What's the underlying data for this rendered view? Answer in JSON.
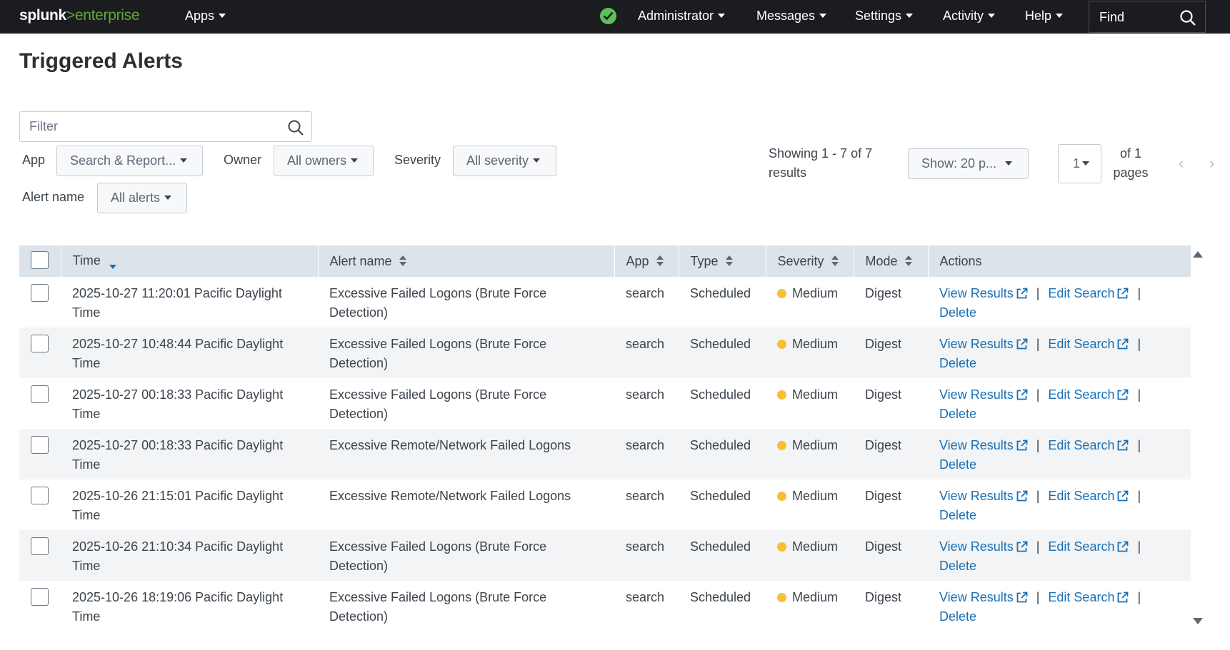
{
  "topbar": {
    "logo_word": "splunk",
    "logo_suffix": ">enterprise",
    "apps": "Apps",
    "user": "Administrator",
    "messages": "Messages",
    "settings": "Settings",
    "activity": "Activity",
    "help": "Help",
    "find": "Find",
    "status_color": "#5cc05c"
  },
  "page": {
    "title": "Triggered Alerts"
  },
  "filters": {
    "filter_placeholder": "Filter",
    "app_label": "App",
    "app_value": "Search & Report...",
    "owner_label": "Owner",
    "owner_value": "All owners",
    "severity_label": "Severity",
    "severity_value": "All severity",
    "alert_name_label": "Alert name",
    "alert_name_value": "All alerts"
  },
  "pagination": {
    "showing": "Showing 1 - 7 of 7 results",
    "page_size": "Show: 20 p...",
    "current_page": "1",
    "of_pages": "of 1 pages",
    "prev_icon": "chevron-left-icon",
    "next_icon": "chevron-right-icon"
  },
  "table": {
    "columns": [
      "Time",
      "Alert name",
      "App",
      "Type",
      "Severity",
      "Mode",
      "Actions"
    ],
    "actions": {
      "view": "View Results",
      "edit": "Edit Search",
      "delete": "Delete",
      "separator": "|"
    },
    "severity_color": "#f8be34",
    "link_color": "#1a6fb3",
    "rows": [
      {
        "time": "2025-10-27 11:20:01 Pacific Daylight Time",
        "alert": "Excessive Failed Logons (Brute Force Detection)",
        "app": "search",
        "type": "Scheduled",
        "severity": "Medium",
        "mode": "Digest"
      },
      {
        "time": "2025-10-27 10:48:44 Pacific Daylight Time",
        "alert": "Excessive Failed Logons (Brute Force Detection)",
        "app": "search",
        "type": "Scheduled",
        "severity": "Medium",
        "mode": "Digest"
      },
      {
        "time": "2025-10-27 00:18:33 Pacific Daylight Time",
        "alert": "Excessive Failed Logons (Brute Force Detection)",
        "app": "search",
        "type": "Scheduled",
        "severity": "Medium",
        "mode": "Digest"
      },
      {
        "time": "2025-10-27 00:18:33 Pacific Daylight Time",
        "alert": "Excessive Remote/Network Failed Logons",
        "app": "search",
        "type": "Scheduled",
        "severity": "Medium",
        "mode": "Digest"
      },
      {
        "time": "2025-10-26 21:15:01 Pacific Daylight Time",
        "alert": "Excessive Remote/Network Failed Logons",
        "app": "search",
        "type": "Scheduled",
        "severity": "Medium",
        "mode": "Digest"
      },
      {
        "time": "2025-10-26 21:10:34 Pacific Daylight Time",
        "alert": "Excessive Failed Logons (Brute Force Detection)",
        "app": "search",
        "type": "Scheduled",
        "severity": "Medium",
        "mode": "Digest"
      },
      {
        "time": "2025-10-26 18:19:06 Pacific Daylight Time",
        "alert": "Excessive Failed Logons (Brute Force Detection)",
        "app": "search",
        "type": "Scheduled",
        "severity": "Medium",
        "mode": "Digest"
      }
    ]
  }
}
